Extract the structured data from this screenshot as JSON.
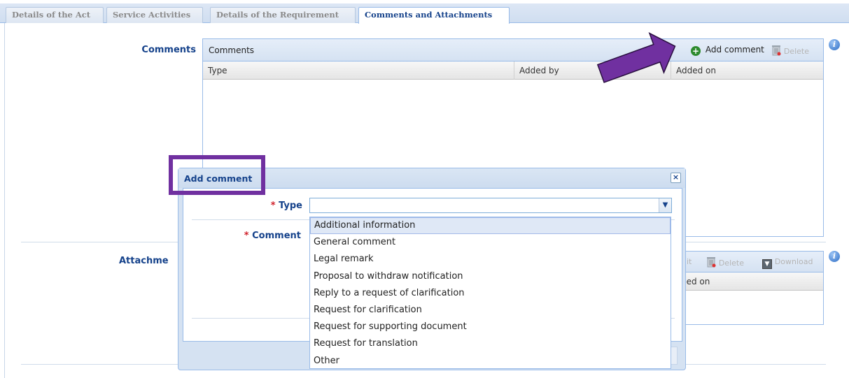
{
  "tabs": [
    {
      "label": "Details of the Act"
    },
    {
      "label": "Service Activities"
    },
    {
      "label": "Details of the Requirement"
    },
    {
      "label": "Comments and Attachments",
      "active": true
    }
  ],
  "comments": {
    "field_label": "Comments",
    "grid_title": "Comments",
    "add_label": "Add comment",
    "delete_label": "Delete",
    "columns": [
      "Type",
      "Added by",
      "Added on"
    ]
  },
  "attachments": {
    "field_label": "Attachme",
    "edit_label": "it",
    "delete_label": "Delete",
    "download_label": "Download",
    "added_on_label": "ded on"
  },
  "dialog": {
    "title": "Add comment",
    "close_glyph": "×",
    "type_label": "Type",
    "comment_label": "Comment",
    "required_mark": "*",
    "type_value": "",
    "options": [
      "Additional information",
      "General comment",
      "Legal remark",
      "Proposal to withdraw notification",
      "Reply to a request of clarification",
      "Request for clarification",
      "Request for supporting document",
      "Request for translation",
      "Other"
    ],
    "highlighted_option": "Additional information"
  },
  "colors": {
    "accent": "#15428b",
    "annotation": "#7030a0",
    "required": "#d0202a"
  }
}
